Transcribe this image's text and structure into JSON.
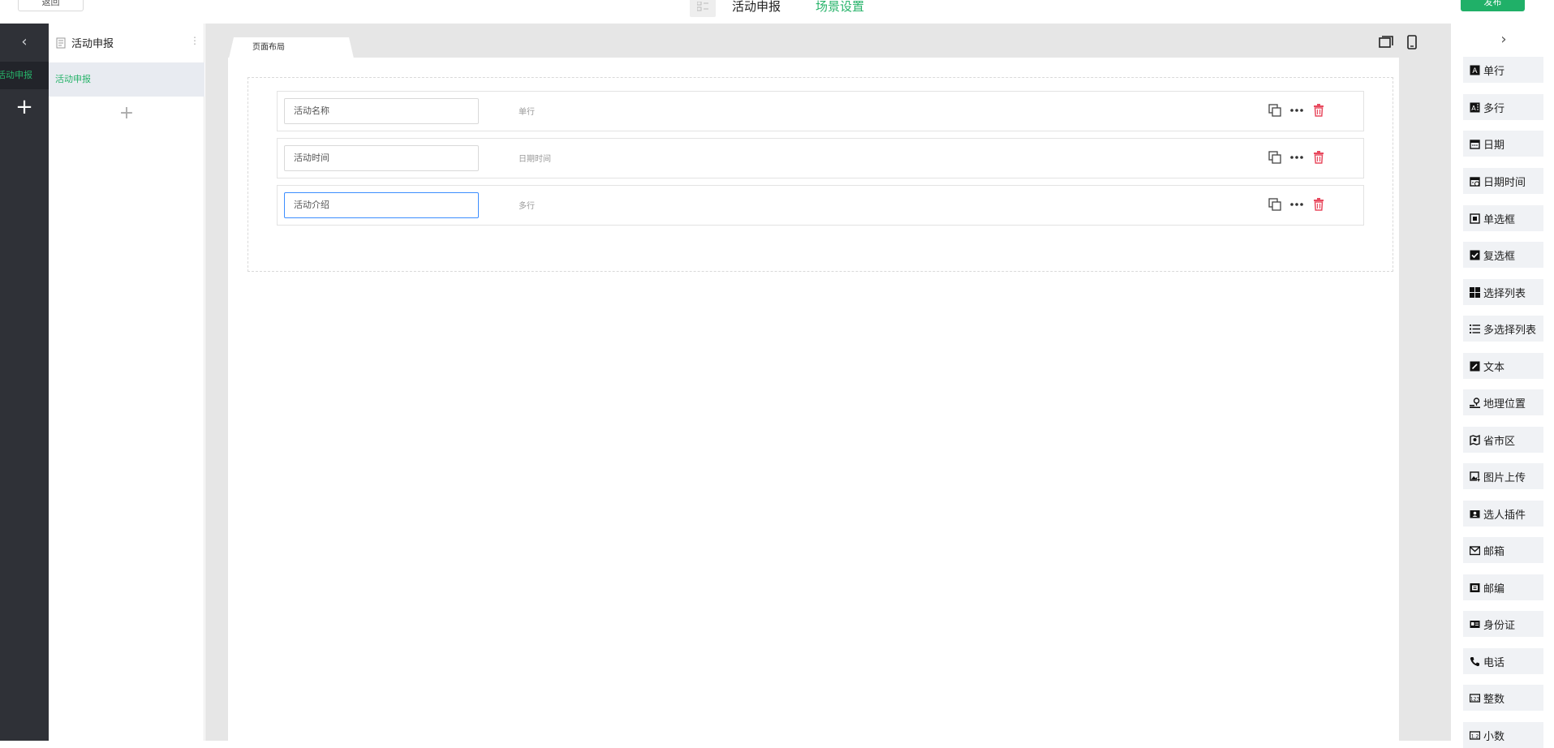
{
  "topbar": {
    "back_label": "返回",
    "title": "活动申报",
    "scene_label": "场景设置",
    "publish_label": "发布",
    "accent_color": "#20b068"
  },
  "rail": {
    "back_icon": "chevron-left-icon",
    "active_item": "活动申报",
    "add_icon": "plus-icon"
  },
  "pages_panel": {
    "title": "活动申报",
    "more_icon": "more-vertical-icon",
    "items": [
      {
        "label": "活动申报"
      }
    ],
    "add_icon": "plus-icon"
  },
  "canvas": {
    "tab_label": "页面布局",
    "device_icons": [
      "desktop-icon",
      "mobile-icon"
    ],
    "fields": [
      {
        "placeholder": "活动名称",
        "type": "单行",
        "focused": false
      },
      {
        "placeholder": "活动时间",
        "type": "日期时间",
        "focused": false
      },
      {
        "placeholder": "活动介绍",
        "type": "多行",
        "focused": true
      }
    ],
    "field_action_icons": [
      "copy-icon",
      "more-horizontal-icon",
      "trash-icon"
    ]
  },
  "components": {
    "collapse_icon": "chevron-right-icon",
    "items": [
      {
        "label": "单行",
        "icon": "single-line-icon"
      },
      {
        "label": "多行",
        "icon": "multi-line-icon"
      },
      {
        "label": "日期",
        "icon": "calendar-icon"
      },
      {
        "label": "日期时间",
        "icon": "datetime-icon"
      },
      {
        "label": "单选框",
        "icon": "radio-icon"
      },
      {
        "label": "复选框",
        "icon": "checkbox-icon"
      },
      {
        "label": "选择列表",
        "icon": "grid-icon"
      },
      {
        "label": "多选择列表",
        "icon": "list-icon"
      },
      {
        "label": "文本",
        "icon": "edit-icon"
      },
      {
        "label": "地理位置",
        "icon": "location-icon"
      },
      {
        "label": "省市区",
        "icon": "map-icon"
      },
      {
        "label": "图片上传",
        "icon": "image-upload-icon"
      },
      {
        "label": "选人插件",
        "icon": "person-picker-icon"
      },
      {
        "label": "邮箱",
        "icon": "mail-icon"
      },
      {
        "label": "邮编",
        "icon": "postcode-icon"
      },
      {
        "label": "身份证",
        "icon": "id-card-icon"
      },
      {
        "label": "电话",
        "icon": "phone-icon"
      },
      {
        "label": "整数",
        "icon": "integer-icon"
      },
      {
        "label": "小数",
        "icon": "decimal-icon"
      }
    ]
  }
}
